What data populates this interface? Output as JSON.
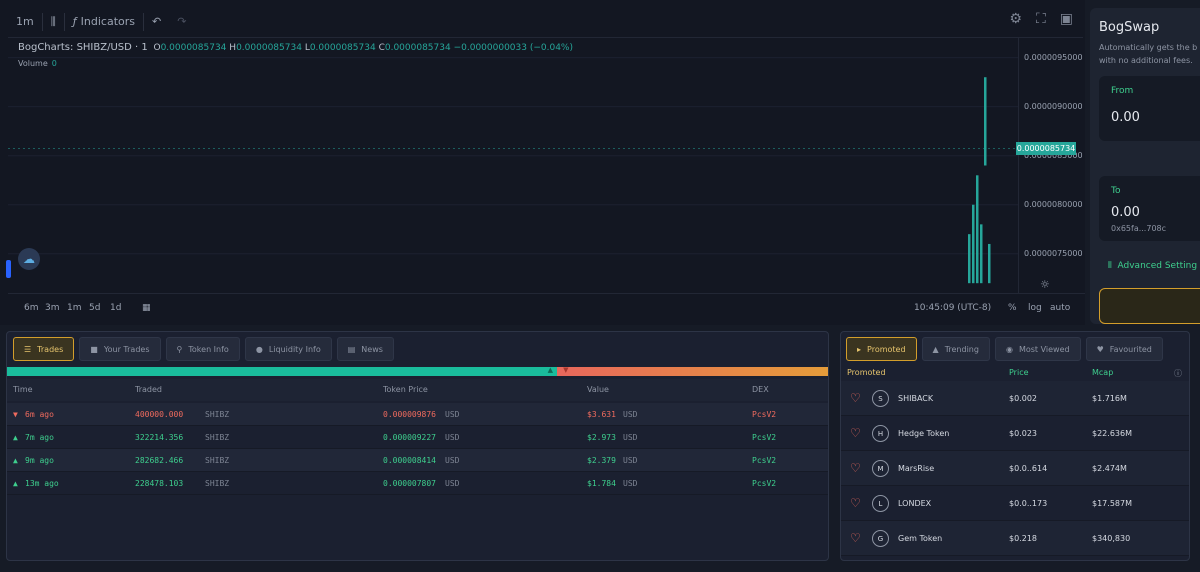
{
  "toolbar": {
    "interval": "1m",
    "indicators_label": "Indicators",
    "icons": [
      "candles-icon",
      "fx-icon",
      "undo-icon",
      "redo-icon",
      "settings-icon",
      "fullscreen-icon",
      "camera-icon"
    ]
  },
  "legend": {
    "symbol": "BogCharts: SHIBZ/USD · 1",
    "o_label": "O",
    "o": "0.0000085734",
    "h_label": "H",
    "h": "0.0000085734",
    "l_label": "L",
    "l": "0.0000085734",
    "c_label": "C",
    "c": "0.0000085734",
    "change": "−0.0000000033 (−0.04%)",
    "volume_label": "Volume",
    "volume": "0"
  },
  "chart_data": {
    "type": "bar",
    "yticks": [
      "0.0000095000",
      "0.0000090000",
      "0.0000085000",
      "0.0000080000",
      "0.0000075000"
    ],
    "ylim": [
      7.1e-06,
      9.7e-06
    ],
    "last_price": "0.0000085734",
    "candles": [
      {
        "o": 7.2e-06,
        "c": 7.7e-06
      },
      {
        "o": 7.2e-06,
        "c": 8e-06
      },
      {
        "o": 7.2e-06,
        "c": 8.3e-06
      },
      {
        "o": 7.2e-06,
        "c": 7.8e-06
      },
      {
        "o": 8.4e-06,
        "c": 9.3e-06
      },
      {
        "o": 7.2e-06,
        "c": 7.6e-06
      }
    ]
  },
  "bottombar": {
    "ranges": [
      "6m",
      "3m",
      "1m",
      "5d",
      "1d"
    ],
    "time": "10:45:09 (UTC-8)",
    "pct": "%",
    "log": "log",
    "auto": "auto"
  },
  "swap": {
    "title": "BogSwap",
    "subtitle1": "Automatically gets the b",
    "subtitle2": "with no additional fees.",
    "from_label": "From",
    "from_value": "0.00",
    "to_label": "To",
    "to_value": "0.00",
    "to_address": "0x65fa...708c",
    "advanced": "Advanced Setting"
  },
  "trades": {
    "tabs": [
      "Trades",
      "Your Trades",
      "Token Info",
      "Liquidity Info",
      "News"
    ],
    "buy_ratio": 0.67,
    "headers": [
      "Time",
      "Traded",
      "Token Price",
      "Value",
      "DEX"
    ],
    "rows": [
      {
        "side": "sell",
        "time": "6m ago",
        "traded": "400000.000",
        "sym": "SHIBZ",
        "price": "0.000009876",
        "cur": "USD",
        "value": "$3.631",
        "vcur": "USD",
        "dex": "PcsV2"
      },
      {
        "side": "buy",
        "time": "7m ago",
        "traded": "322214.356",
        "sym": "SHIBZ",
        "price": "0.000009227",
        "cur": "USD",
        "value": "$2.973",
        "vcur": "USD",
        "dex": "PcsV2"
      },
      {
        "side": "buy",
        "time": "9m ago",
        "traded": "282682.466",
        "sym": "SHIBZ",
        "price": "0.000008414",
        "cur": "USD",
        "value": "$2.379",
        "vcur": "USD",
        "dex": "PcsV2"
      },
      {
        "side": "buy",
        "time": "13m ago",
        "traded": "228478.103",
        "sym": "SHIBZ",
        "price": "0.000007807",
        "cur": "USD",
        "value": "$1.784",
        "vcur": "USD",
        "dex": "PcsV2"
      }
    ]
  },
  "promo": {
    "tabs": [
      "Promoted",
      "Trending",
      "Most Viewed",
      "Favourited"
    ],
    "headers": [
      "Promoted",
      "Price",
      "Mcap"
    ],
    "rows": [
      {
        "name": "SHIBACK",
        "price": "$0.002",
        "mcap": "$1.716M",
        "icon": "S"
      },
      {
        "name": "Hedge Token",
        "price": "$0.023",
        "mcap": "$22.636M",
        "icon": "H"
      },
      {
        "name": "MarsRise",
        "price": "$0.0..614",
        "mcap": "$2.474M",
        "icon": "M"
      },
      {
        "name": "LONDEX",
        "price": "$0.0..173",
        "mcap": "$17.587M",
        "icon": "L"
      },
      {
        "name": "Gem Token",
        "price": "$0.218",
        "mcap": "$340,830",
        "icon": "G"
      }
    ]
  }
}
